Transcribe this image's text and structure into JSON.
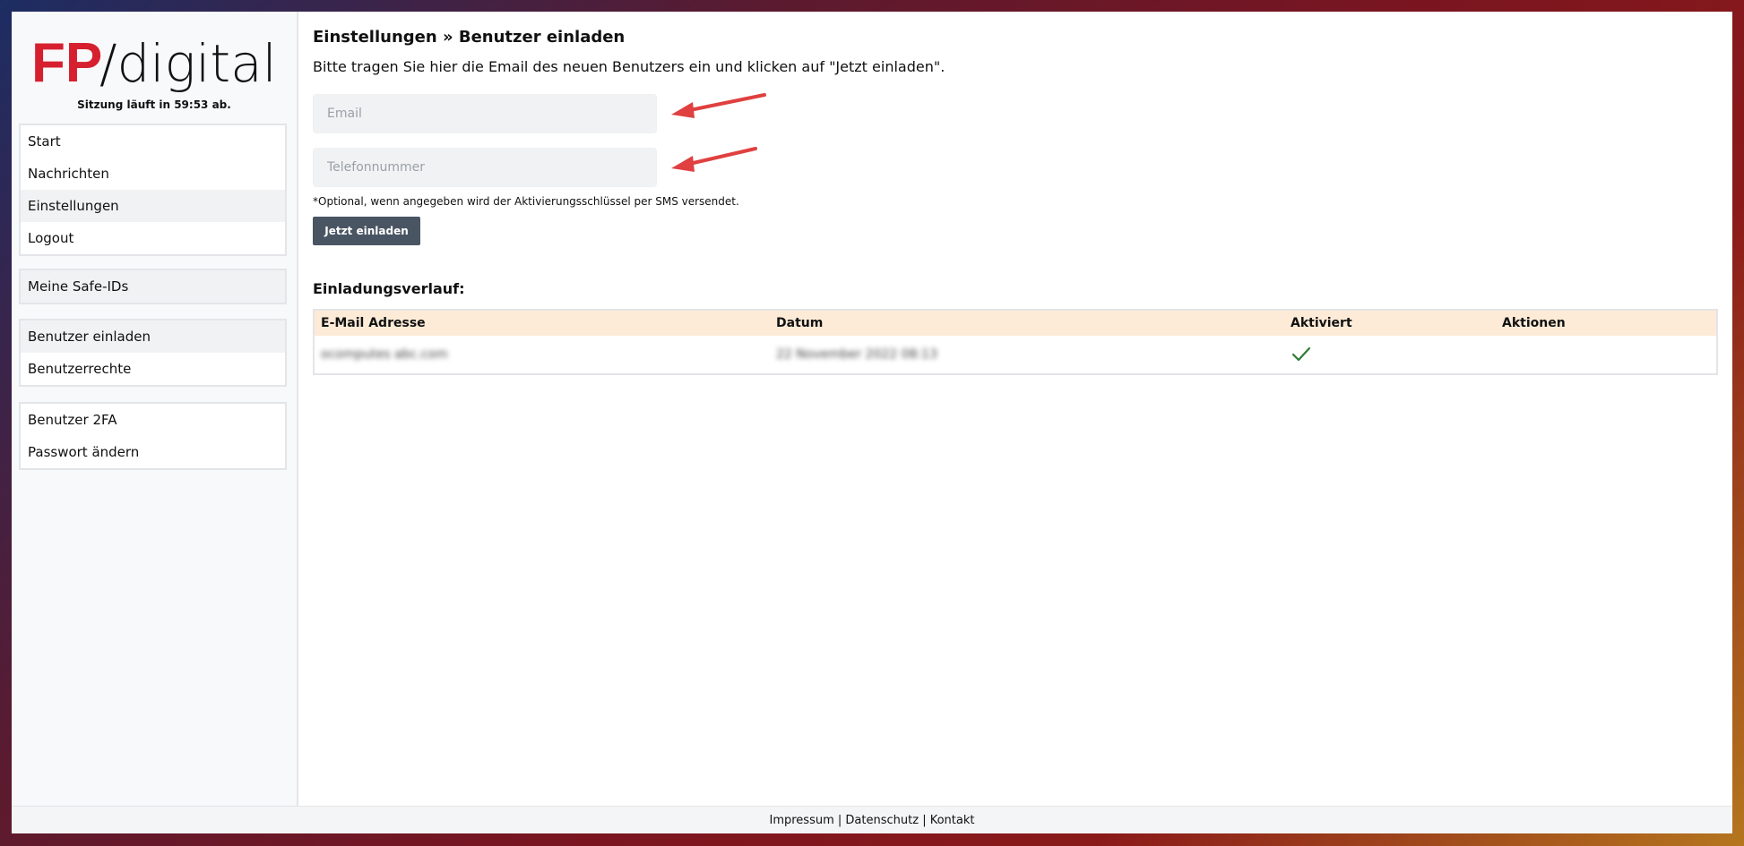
{
  "brand": {
    "logo_mark": "FP",
    "logo_text": "/digital",
    "accent_color": "#d6202f"
  },
  "session": {
    "text": "Sitzung läuft in 59:53 ab."
  },
  "sidebar": {
    "groups": [
      {
        "items": [
          {
            "label": "Start"
          },
          {
            "label": "Nachrichten"
          },
          {
            "label": "Einstellungen"
          },
          {
            "label": "Logout"
          }
        ]
      },
      {
        "items": [
          {
            "label": "Meine Safe-IDs"
          }
        ]
      },
      {
        "items": [
          {
            "label": "Benutzer einladen"
          },
          {
            "label": "Benutzerrechte"
          }
        ]
      },
      {
        "items": [
          {
            "label": "Benutzer 2FA"
          },
          {
            "label": "Passwort ändern"
          }
        ]
      }
    ]
  },
  "main": {
    "title": "Einstellungen » Benutzer einladen",
    "intro": "Bitte tragen Sie hier die Email des neuen Benutzers ein und klicken auf \"Jetzt einladen\".",
    "email": {
      "placeholder": "Email",
      "value": ""
    },
    "phone": {
      "placeholder": "Telefonnummer",
      "value": ""
    },
    "hint": "*Optional, wenn angegeben wird der Aktivierungsschlüssel per SMS versendet.",
    "invite_button": "Jetzt einladen",
    "history_title": "Einladungsverlauf:",
    "table": {
      "columns": [
        "E-Mail Adresse",
        "Datum",
        "Aktiviert",
        "Aktionen"
      ],
      "rows": [
        {
          "email": "ocomputes abc.com",
          "date": "22 November 2022 08:13",
          "activated": true,
          "actions": ""
        }
      ]
    }
  },
  "footer": {
    "links": [
      "Impressum",
      "Datenschutz",
      "Kontakt"
    ],
    "separator": " | "
  },
  "colors": {
    "annotation_arrow": "#e04040",
    "check": "#2e7d32",
    "table_header_bg": "#fdebd7",
    "button_bg": "#4a5563"
  }
}
